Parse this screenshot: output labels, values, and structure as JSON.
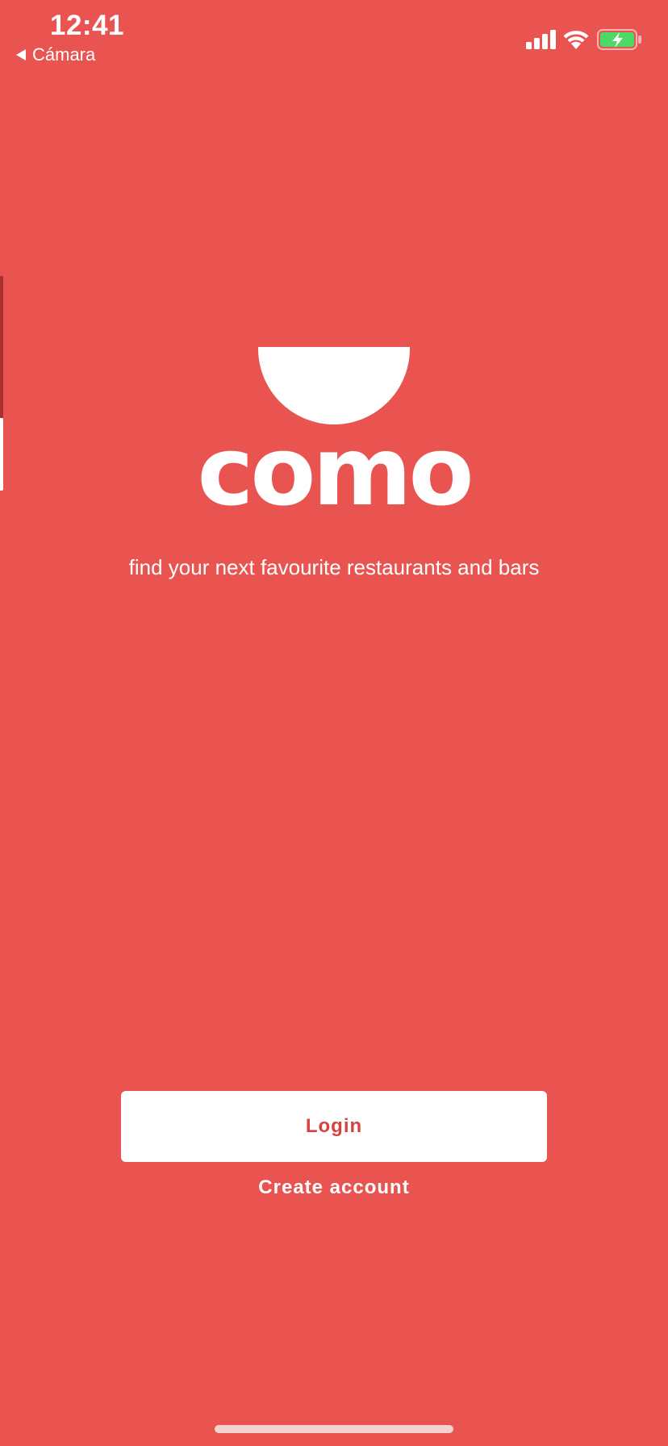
{
  "status_bar": {
    "time": "12:41",
    "back_label": "Cámara",
    "icons": [
      "signal-icon",
      "wifi-icon",
      "battery-charging-icon"
    ]
  },
  "logo": {
    "wordmark": "como",
    "symbol": "bowl-logo-icon"
  },
  "tagline": "find your next favourite restaurants and bars",
  "actions": {
    "login_label": "Login",
    "create_account_label": "Create account"
  },
  "colors": {
    "background": "#E95450",
    "button_background": "#FFFFFF",
    "button_text": "#D8413D",
    "text": "#FFFFFF",
    "battery_fill": "#4CD964"
  }
}
